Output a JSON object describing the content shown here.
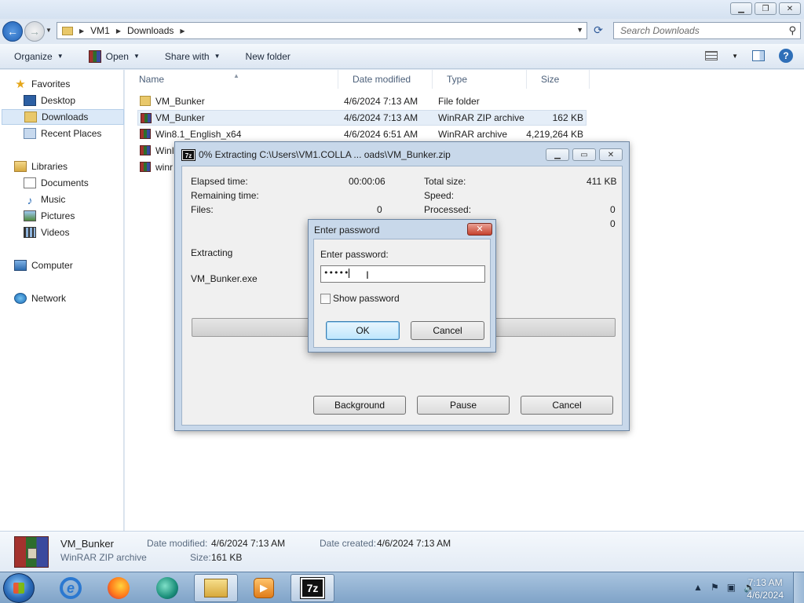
{
  "explorer": {
    "breadcrumb": [
      "VM1",
      "Downloads"
    ],
    "search_placeholder": "Search Downloads",
    "toolbar": {
      "organize": "Organize",
      "open": "Open",
      "share_with": "Share with",
      "new_folder": "New folder"
    },
    "nav": {
      "favorites": "Favorites",
      "desktop": "Desktop",
      "downloads": "Downloads",
      "recent_places": "Recent Places",
      "libraries": "Libraries",
      "documents": "Documents",
      "music": "Music",
      "pictures": "Pictures",
      "videos": "Videos",
      "computer": "Computer",
      "network": "Network"
    },
    "columns": {
      "name": "Name",
      "date_modified": "Date modified",
      "type": "Type",
      "size": "Size"
    },
    "files": [
      {
        "name": "VM_Bunker",
        "date": "4/6/2024 7:13 AM",
        "type": "File folder",
        "size": ""
      },
      {
        "name": "VM_Bunker",
        "date": "4/6/2024 7:13 AM",
        "type": "WinRAR ZIP archive",
        "size": "162 KB"
      },
      {
        "name": "Win8.1_English_x64",
        "date": "4/6/2024 6:51 AM",
        "type": "WinRAR archive",
        "size": "4,219,264 KB"
      },
      {
        "name": "WinI",
        "date": "",
        "type": "",
        "size": ""
      },
      {
        "name": "winr",
        "date": "",
        "type": "",
        "size": ""
      }
    ],
    "details": {
      "name": "VM_Bunker",
      "type": "WinRAR ZIP archive",
      "date_modified_label": "Date modified:",
      "date_modified": "4/6/2024 7:13 AM",
      "size_label": "Size:",
      "size": "161 KB",
      "date_created_label": "Date created:",
      "date_created": "4/6/2024 7:13 AM"
    }
  },
  "progress_dialog": {
    "title": "0% Extracting C:\\Users\\VM1.COLLA ... oads\\VM_Bunker.zip",
    "app_icon_text": "7z",
    "elapsed_label": "Elapsed time:",
    "elapsed": "00:00:06",
    "remaining_label": "Remaining time:",
    "files_label": "Files:",
    "files": "0",
    "total_size_label": "Total size:",
    "total_size": "411 KB",
    "speed_label": "Speed:",
    "processed_label": "Processed:",
    "processed": "0",
    "extra_value": "0",
    "extracting_label": "Extracting",
    "current_file": "VM_Bunker.exe",
    "progress": 0,
    "buttons": {
      "background": "Background",
      "pause": "Pause",
      "cancel": "Cancel"
    }
  },
  "password_dialog": {
    "title": "Enter password",
    "field_label": "Enter password:",
    "masked_value": "•••••",
    "show_password_label": "Show password",
    "ok": "OK",
    "cancel": "Cancel"
  },
  "taskbar": {
    "time": "7:13 AM",
    "date": "4/6/2024",
    "sevenzip_label": "7z"
  }
}
